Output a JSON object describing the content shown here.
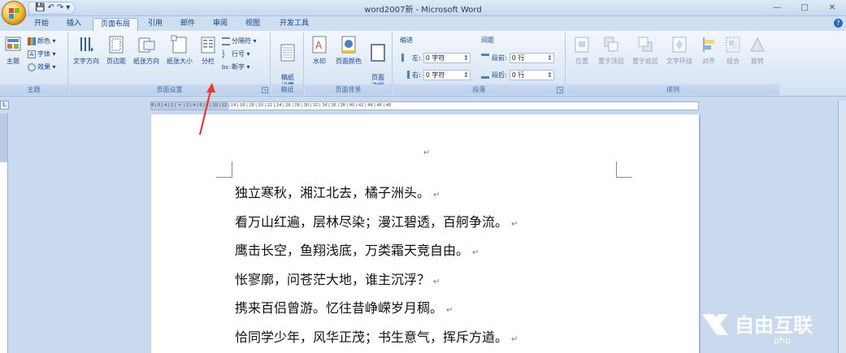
{
  "window": {
    "title": "word2007新 - Microsoft Word",
    "controls": [
      "—",
      "□",
      "✕"
    ]
  },
  "quick_access": [
    "💾",
    "↶",
    "↷",
    "▾"
  ],
  "tabs": [
    {
      "label": "开始",
      "active": false
    },
    {
      "label": "插入",
      "active": false
    },
    {
      "label": "页面布局",
      "active": true
    },
    {
      "label": "引用",
      "active": false
    },
    {
      "label": "邮件",
      "active": false
    },
    {
      "label": "审阅",
      "active": false
    },
    {
      "label": "视图",
      "active": false
    },
    {
      "label": "开发工具",
      "active": false
    }
  ],
  "groups": {
    "theme": {
      "label": "主题",
      "big": "主题",
      "small": [
        "颜色 ▾",
        "字体 ▾",
        "效果 ▾"
      ]
    },
    "page_setup": {
      "label": "页面设置",
      "buttons": [
        "文字方向",
        "页边距",
        "纸张方向",
        "纸张大小",
        "分栏"
      ],
      "small": [
        "分隔符 ▾",
        "行号 ▾",
        "断字 ▾"
      ]
    },
    "draft": {
      "label": "稿纸",
      "button": "稿纸\n设置"
    },
    "page_bg": {
      "label": "页面背景",
      "buttons": [
        "水印",
        "页面颜色",
        "页面\n边框"
      ]
    },
    "paragraph": {
      "label": "段落",
      "indent_title": "缩进",
      "spacing_title": "间距",
      "indent_left_label": "左:",
      "indent_left_value": "0 字符",
      "indent_right_label": "右:",
      "indent_right_value": "0 字符",
      "before_label": "段前:",
      "before_value": "0 行",
      "after_label": "段后:",
      "after_value": "0 行"
    },
    "arrange": {
      "label": "排列",
      "buttons": [
        "位置",
        "置于顶层",
        "置于底层",
        "文字环绕",
        "对齐",
        "组合",
        "旋转"
      ]
    }
  },
  "ruler": {
    "corner": "L",
    "ticks": "8 | 6 | 4 | 2 | 🔻 | 2 | 4 | 6 | 8 | 10 | 12 | 14 | 16 | 18 | 20 | 22 | 24 | 26 | 28 | 30 | 32 | 34 | 36 | 38 | 40 | 42 | 44 | 46 | 48"
  },
  "document": {
    "top_mark": "↵",
    "lines": [
      "独立寒秋，湘江北去，橘子洲头。",
      "看万山红遍，层林尽染；漫江碧透，百舸争流。",
      "鹰击长空，鱼翔浅底，万类霜天竞自由。",
      "怅寥廓，问苍茫大地，谁主沉浮？",
      "携来百侣曾游。忆往昔峥嵘岁月稠。",
      "恰同学少年，风华正茂；书生意气，挥斥方遒。"
    ],
    "para_mark": "↵"
  },
  "watermark": {
    "brand": "自由互联",
    "tag": "php"
  },
  "colors": {
    "accent": "#15428b",
    "annotation_arrow": "#e53935"
  }
}
